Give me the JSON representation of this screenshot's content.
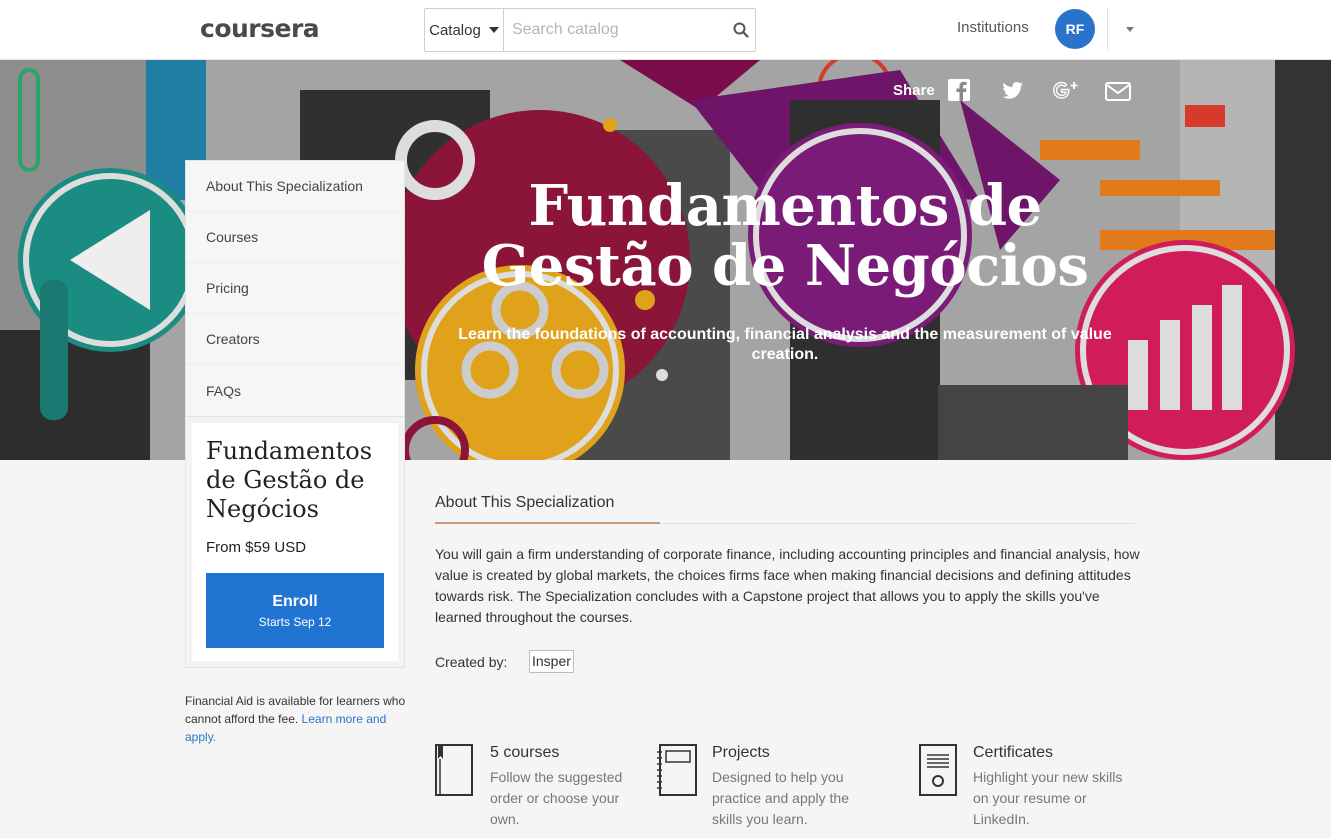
{
  "header": {
    "logo": "coursera",
    "catalog_label": "Catalog",
    "search_placeholder": "Search catalog",
    "institutions_label": "Institutions",
    "user_initials": "RF"
  },
  "hero": {
    "share_label": "Share",
    "title": "Fundamentos de Gestão de Negócios",
    "subtitle": "Learn the foundations of accounting, financial analysis and the measurement of value creation."
  },
  "sidebar": {
    "items": [
      {
        "label": "About This Specialization"
      },
      {
        "label": "Courses"
      },
      {
        "label": "Pricing"
      },
      {
        "label": "Creators"
      },
      {
        "label": "FAQs"
      }
    ]
  },
  "enroll_card": {
    "title": "Fundamentos de Gestão de Negócios",
    "price": "From $59 USD",
    "enroll_label": "Enroll",
    "starts": "Starts Sep 12"
  },
  "financial_aid": {
    "text": "Financial Aid is available for learners who cannot afford the fee.",
    "link": "Learn more and apply."
  },
  "about": {
    "heading": "About This Specialization",
    "body": "You will gain a firm understanding of corporate finance, including accounting principles and financial analysis, how value is created by global markets, the choices firms face when making financial decisions and defining attitudes towards risk. The Specialization concludes with a Capstone project that allows you to apply the skills you've learned throughout the courses.",
    "created_by_label": "Created by:",
    "creator": "Insper"
  },
  "features": [
    {
      "icon": "book-icon",
      "title": "5 courses",
      "desc": "Follow the suggested order or choose your own."
    },
    {
      "icon": "notebook-icon",
      "title": "Projects",
      "desc": "Designed to help you practice and apply the skills you learn."
    },
    {
      "icon": "certificate-icon",
      "title": "Certificates",
      "desc": "Highlight your new skills on your resume or LinkedIn."
    }
  ],
  "colors": {
    "brand_blue": "#2274d3",
    "avatar_blue": "#2a73cc",
    "accent_rule": "#c79a7b"
  }
}
